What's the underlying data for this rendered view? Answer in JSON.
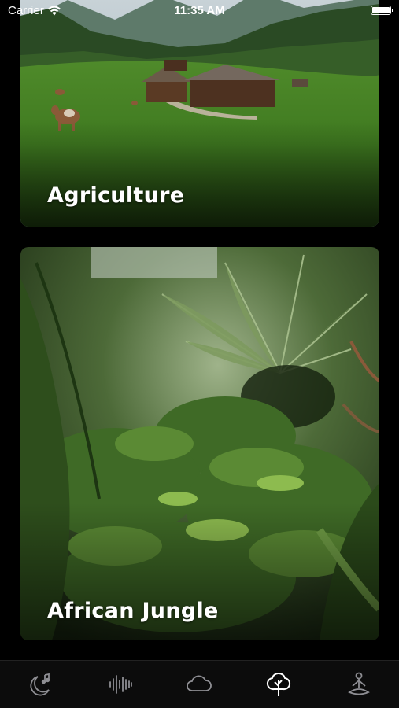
{
  "status_bar": {
    "carrier": "Carrier",
    "time": "11:35 AM",
    "battery_level": 1.0
  },
  "cards": [
    {
      "title": "Agriculture",
      "image": "farm-meadow-cows-photo"
    },
    {
      "title": "African Jungle",
      "image": "jungle-ferns-photo"
    }
  ],
  "tab_bar": {
    "tabs": [
      {
        "icon": "moon-music-icon",
        "active": false
      },
      {
        "icon": "soundwave-icon",
        "active": false
      },
      {
        "icon": "cloud-icon",
        "active": false
      },
      {
        "icon": "tree-icon",
        "active": true
      },
      {
        "icon": "meditation-icon",
        "active": false
      }
    ]
  },
  "colors": {
    "background": "#000000",
    "tab_icon": "#8e8e93",
    "tab_icon_active": "#ffffff"
  }
}
